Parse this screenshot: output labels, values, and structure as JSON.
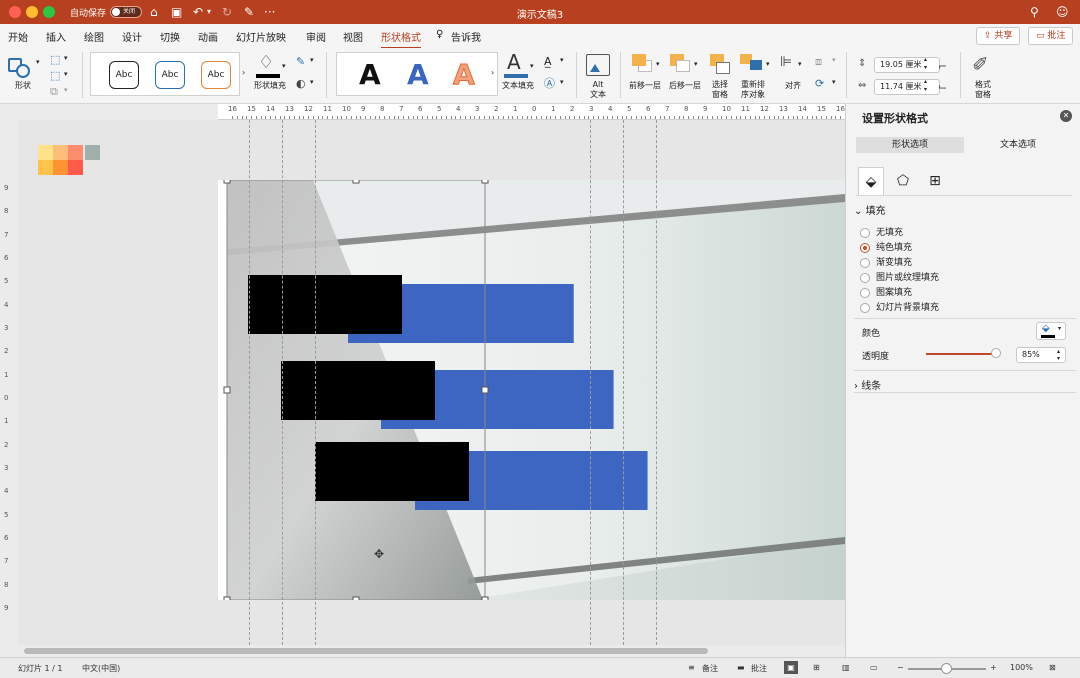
{
  "window": {
    "autosave_label": "自动保存",
    "autosave_state": "关闭",
    "more_label": "···",
    "doc_title": "演示文稿3"
  },
  "tabs": [
    {
      "label": "开始"
    },
    {
      "label": "插入"
    },
    {
      "label": "绘图"
    },
    {
      "label": "设计"
    },
    {
      "label": "切换"
    },
    {
      "label": "动画"
    },
    {
      "label": "幻灯片放映"
    },
    {
      "label": "审阅"
    },
    {
      "label": "视图"
    },
    {
      "label": "形状格式",
      "active": true
    },
    {
      "label": "告诉我"
    }
  ],
  "tab_buttons": {
    "share": "共享",
    "comments": "批注"
  },
  "ribbon": {
    "shape_label": "形状",
    "style_abc": "Abc",
    "shape_fill": "形状填充",
    "wordart_letter": "A",
    "text_fill": "文本填充",
    "alt_text": "Alt\n文本",
    "bring_forward": "前移一层",
    "send_backward": "后移一层",
    "selection_pane": "选择\n窗格",
    "reorder": "重新排\n序对象",
    "align": "对齐",
    "height_value": "19.05 厘米",
    "width_value": "11.74 厘米",
    "format_pane": "格式\n窗格"
  },
  "ruler_top": [
    "16",
    "15",
    "14",
    "13",
    "12",
    "11",
    "10",
    "9",
    "8",
    "7",
    "6",
    "5",
    "4",
    "3",
    "2",
    "1",
    "0",
    "1",
    "2",
    "3",
    "4",
    "5",
    "6",
    "7",
    "8",
    "9",
    "10",
    "11",
    "12",
    "13",
    "14",
    "15",
    "16"
  ],
  "ruler_left": [
    "9",
    "8",
    "7",
    "6",
    "5",
    "4",
    "3",
    "2",
    "1",
    "0",
    "1",
    "2",
    "3",
    "4",
    "5",
    "6",
    "7",
    "8",
    "9"
  ],
  "palette_colors": [
    "#ffe28a",
    "#ffbe78",
    "#ff8c6e",
    "#9fafac",
    "#ffc24d",
    "#ff9233",
    "#ff5a4a"
  ],
  "slide": {
    "bar_color": "#3c66c1",
    "block_color": "#000000",
    "bar_values": [
      0.66,
      0.68,
      0.68
    ]
  },
  "format_pane": {
    "title": "设置形状格式",
    "tab_shape": "形状选项",
    "tab_text": "文本选项",
    "fill_section": "填充",
    "fill_options": [
      {
        "label": "无填充",
        "selected": false
      },
      {
        "label": "纯色填充",
        "selected": true
      },
      {
        "label": "渐变填充",
        "selected": false
      },
      {
        "label": "图片或纹理填充",
        "selected": false
      },
      {
        "label": "图案填充",
        "selected": false
      },
      {
        "label": "幻灯片背景填充",
        "selected": false
      }
    ],
    "color_label": "颜色",
    "transparency_label": "透明度",
    "transparency_value": "85%",
    "transparency_level": 0.85,
    "line_section": "线条"
  },
  "status": {
    "slide_info": "幻灯片 1 / 1",
    "language": "中文(中国)",
    "notes": "备注",
    "comments": "批注",
    "zoom": "100%"
  }
}
